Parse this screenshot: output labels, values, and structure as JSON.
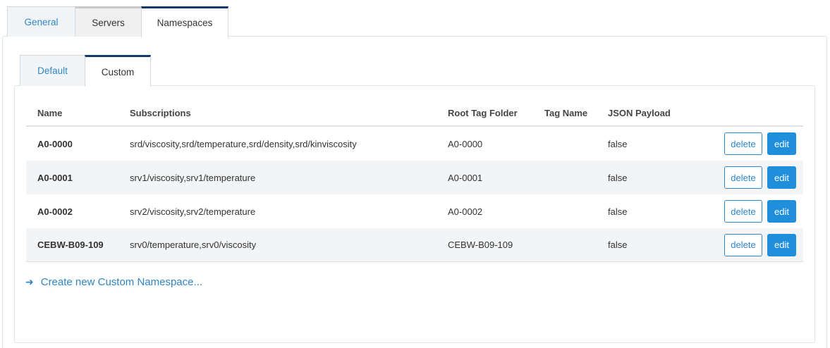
{
  "outer_tabs": {
    "general": "General",
    "servers": "Servers",
    "namespaces": "Namespaces"
  },
  "inner_tabs": {
    "default": "Default",
    "custom": "Custom"
  },
  "table": {
    "headers": {
      "name": "Name",
      "subscriptions": "Subscriptions",
      "root_tag_folder": "Root Tag Folder",
      "tag_name": "Tag Name",
      "json_payload": "JSON Payload"
    },
    "rows": [
      {
        "name": "A0-0000",
        "subscriptions": "srd/viscosity,srd/temperature,srd/density,srd/kinviscosity",
        "root_tag_folder": "A0-0000",
        "tag_name": "",
        "json_payload": "false",
        "delete_label": "delete",
        "edit_label": "edit"
      },
      {
        "name": "A0-0001",
        "subscriptions": "srv1/viscosity,srv1/temperature",
        "root_tag_folder": "A0-0001",
        "tag_name": "",
        "json_payload": "false",
        "delete_label": "delete",
        "edit_label": "edit"
      },
      {
        "name": "A0-0002",
        "subscriptions": "srv2/viscosity,srv2/temperature",
        "root_tag_folder": "A0-0002",
        "tag_name": "",
        "json_payload": "false",
        "delete_label": "delete",
        "edit_label": "edit"
      },
      {
        "name": "CEBW-B09-109",
        "subscriptions": "srv0/temperature,srv0/viscosity",
        "root_tag_folder": "CEBW-B09-109",
        "tag_name": "",
        "json_payload": "false",
        "delete_label": "delete",
        "edit_label": "edit"
      }
    ]
  },
  "create_link": {
    "arrow": "➜",
    "label": "Create new Custom Namespace..."
  },
  "colors": {
    "accent": "#2f86c8",
    "edit_button": "#1f8fdc",
    "active_tab_border": "#0f3a6b",
    "row_alt": "#f2f4f6"
  }
}
